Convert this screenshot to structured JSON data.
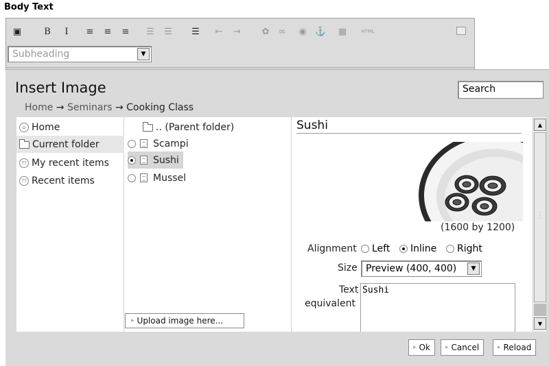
{
  "field_label": "Body Text",
  "toolbar": {
    "buttons": [
      {
        "name": "save-icon",
        "glyph": "▣",
        "dark": true
      },
      {
        "name": "bold-icon",
        "glyph": "B",
        "dark": true
      },
      {
        "name": "italic-icon",
        "glyph": "I",
        "dark": true
      },
      {
        "name": "align-left-icon",
        "glyph": "≡",
        "dark": true
      },
      {
        "name": "align-center-icon",
        "glyph": "≡",
        "dark": true
      },
      {
        "name": "align-right-icon",
        "glyph": "≡",
        "dark": true
      },
      {
        "name": "numbered-list-icon",
        "glyph": "☰",
        "dark": false
      },
      {
        "name": "bullet-list-icon",
        "glyph": "☰",
        "dark": false
      },
      {
        "name": "definition-list-icon",
        "glyph": "☰",
        "dark": true
      },
      {
        "name": "outdent-icon",
        "glyph": "⇤",
        "dark": false
      },
      {
        "name": "indent-icon",
        "glyph": "⇥",
        "dark": false
      },
      {
        "name": "image-icon",
        "glyph": "✿",
        "dark": false
      },
      {
        "name": "link-icon",
        "glyph": "∞",
        "dark": false
      },
      {
        "name": "external-link-icon",
        "glyph": "◉",
        "dark": false
      },
      {
        "name": "anchor-icon",
        "glyph": "⚓",
        "dark": false
      },
      {
        "name": "table-icon",
        "glyph": "▦",
        "dark": false
      },
      {
        "name": "html-source-icon",
        "glyph": "HTML",
        "dark": false
      }
    ],
    "format_value": "Subheading"
  },
  "dialog": {
    "title": "Insert Image",
    "search_value": "Search",
    "breadcrumb": {
      "home": "Home",
      "sep": "→",
      "mid": "Seminars",
      "current": "Cooking Class"
    },
    "nav": [
      {
        "label": "Home",
        "icon": "home-icon"
      },
      {
        "label": "Current folder",
        "icon": "folder-icon"
      },
      {
        "label": "My recent items",
        "icon": "recent-items-icon"
      },
      {
        "label": "Recent items",
        "icon": "recent-items-icon"
      }
    ],
    "files": {
      "parent": ".. (Parent folder)",
      "items": [
        {
          "label": "Scampi",
          "selected": false
        },
        {
          "label": "Sushi",
          "selected": true
        },
        {
          "label": "Mussel",
          "selected": false
        }
      ]
    },
    "upload_label": "Upload image here...",
    "detail": {
      "title": "Sushi",
      "image_size": "(1600 by 1200)",
      "alignment_label": "Alignment",
      "alignment_options": [
        "Left",
        "Inline",
        "Right"
      ],
      "alignment_selected": "Inline",
      "size_label": "Size",
      "size_value": "Preview (400, 400)",
      "text_label_1": "Text",
      "text_label_2": "equivalent",
      "text_value": "Sushi"
    },
    "buttons": {
      "ok": "Ok",
      "cancel": "Cancel",
      "reload": "Reload"
    }
  }
}
